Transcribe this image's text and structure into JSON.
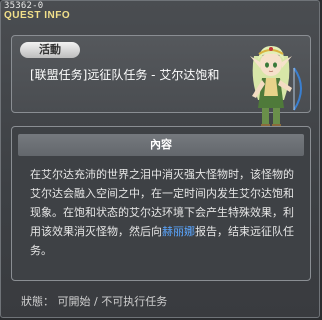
{
  "header": {
    "quest_id": "35362-0",
    "title": "QUEST INFO"
  },
  "summary": {
    "badge": "活動",
    "quest_name": "[联盟任务]远征队任务 - 艾尔达饱和"
  },
  "content": {
    "section_title": "內容",
    "description_before": "在艾尔达充沛的世界之泪中消灭强大怪物时，该怪物的艾尔达会融入空间之中，在一定时间内发生艾尔达饱和现象。在饱和状态的艾尔达环境下会产生特殊效果，利用该效果消灭怪物，然后向",
    "npc_name": "赫丽娜",
    "description_after": "报告，结束远征队任务。"
  },
  "status": {
    "label": "狀態",
    "value": "可開始 / 不可执行任务"
  },
  "colors": {
    "title": "#f2e08a",
    "npc_link": "#5aa6ff"
  }
}
